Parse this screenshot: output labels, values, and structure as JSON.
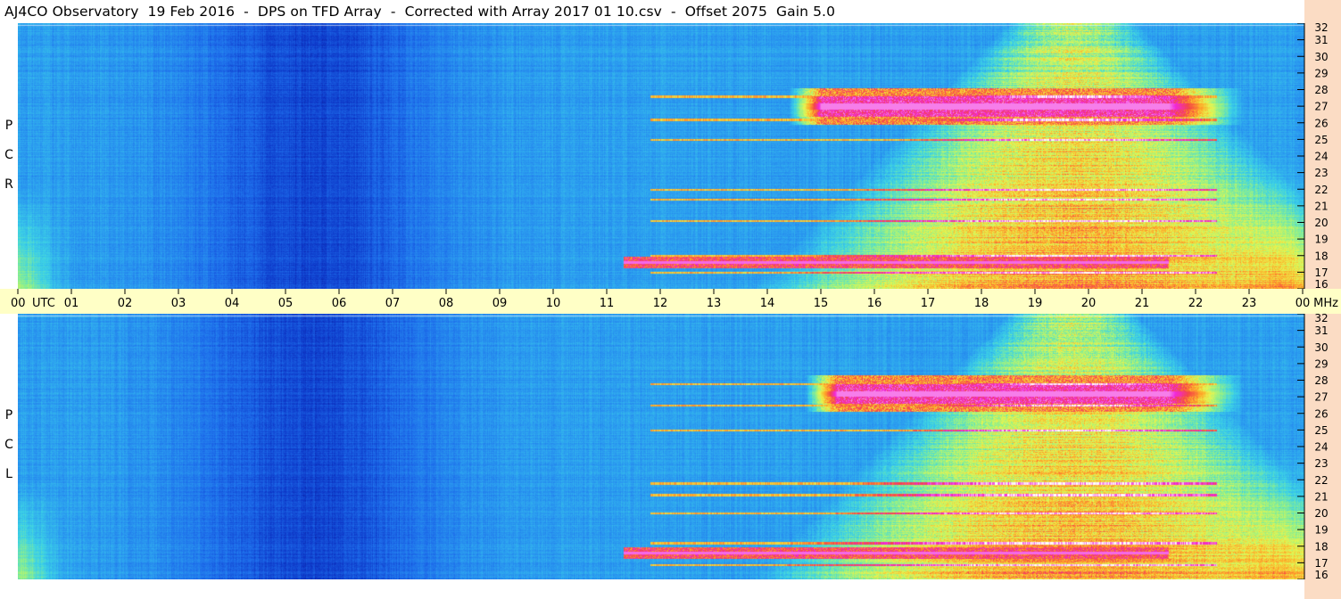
{
  "title": "AJ4CO Observatory  19 Feb 2016  -  DPS on TFD Array  -  Corrected with Array 2017 01 10.csv  -  Offset 2075  Gain 5.0",
  "colors": {
    "axis_band": "#ffffc6",
    "right_band": "#fbdcc4",
    "colormap": [
      "#0a0a78",
      "#0d37c8",
      "#1e6eeb",
      "#2ca0f0",
      "#3cd2e6",
      "#8ef08c",
      "#e6f550",
      "#ffaa28",
      "#f54646",
      "#f028dc",
      "#ffffff"
    ]
  },
  "chart_data": {
    "type": "heatmap",
    "title": "AJ4CO Observatory  19 Feb 2016  -  DPS on TFD Array  -  Corrected with Array 2017 01 10.csv  -  Offset 2075  Gain 5.0",
    "x_axis": {
      "unit_label": "UTC",
      "range": [
        0,
        24
      ],
      "tick_labels": [
        "00",
        "01",
        "02",
        "03",
        "04",
        "05",
        "06",
        "07",
        "08",
        "09",
        "10",
        "11",
        "12",
        "13",
        "14",
        "15",
        "16",
        "17",
        "18",
        "19",
        "20",
        "21",
        "22",
        "23",
        "00"
      ]
    },
    "y_axis": {
      "unit_label": "MHz",
      "range": [
        16,
        32
      ],
      "tick_labels": [
        "16",
        "17",
        "18",
        "19",
        "20",
        "21",
        "22",
        "23",
        "24",
        "25",
        "26",
        "27",
        "28",
        "29",
        "30",
        "31",
        "32"
      ]
    },
    "panels": [
      {
        "name": "RCP",
        "label_letters": [
          "R",
          "C",
          "P"
        ],
        "features": {
          "galactic_background_peak_utc": 19.7,
          "galactic_background_span_utc": [
            12.0,
            24.0
          ],
          "quiet_minimum_utc": 5.5,
          "saturated_band_mhz": 27.0,
          "saturated_band_utc": [
            15.0,
            21.5
          ],
          "secondary_band_mhz": 17.6,
          "secondary_band_utc": [
            11.3,
            21.5
          ],
          "interference_lines_mhz": [
            21.4,
            22.0,
            25.0,
            26.2,
            27.6,
            20.1,
            17.0,
            18.0
          ]
        }
      },
      {
        "name": "LCP",
        "label_letters": [
          "L",
          "C",
          "P"
        ],
        "features": {
          "galactic_background_peak_utc": 19.7,
          "galactic_background_span_utc": [
            12.0,
            24.0
          ],
          "quiet_minimum_utc": 5.5,
          "saturated_band_mhz": 27.2,
          "saturated_band_utc": [
            15.3,
            21.5
          ],
          "secondary_band_mhz": 17.6,
          "secondary_band_utc": [
            11.3,
            21.5
          ],
          "interference_lines_mhz": [
            21.1,
            21.8,
            25.0,
            26.5,
            27.8,
            20.0,
            16.9,
            18.2
          ]
        }
      }
    ]
  }
}
